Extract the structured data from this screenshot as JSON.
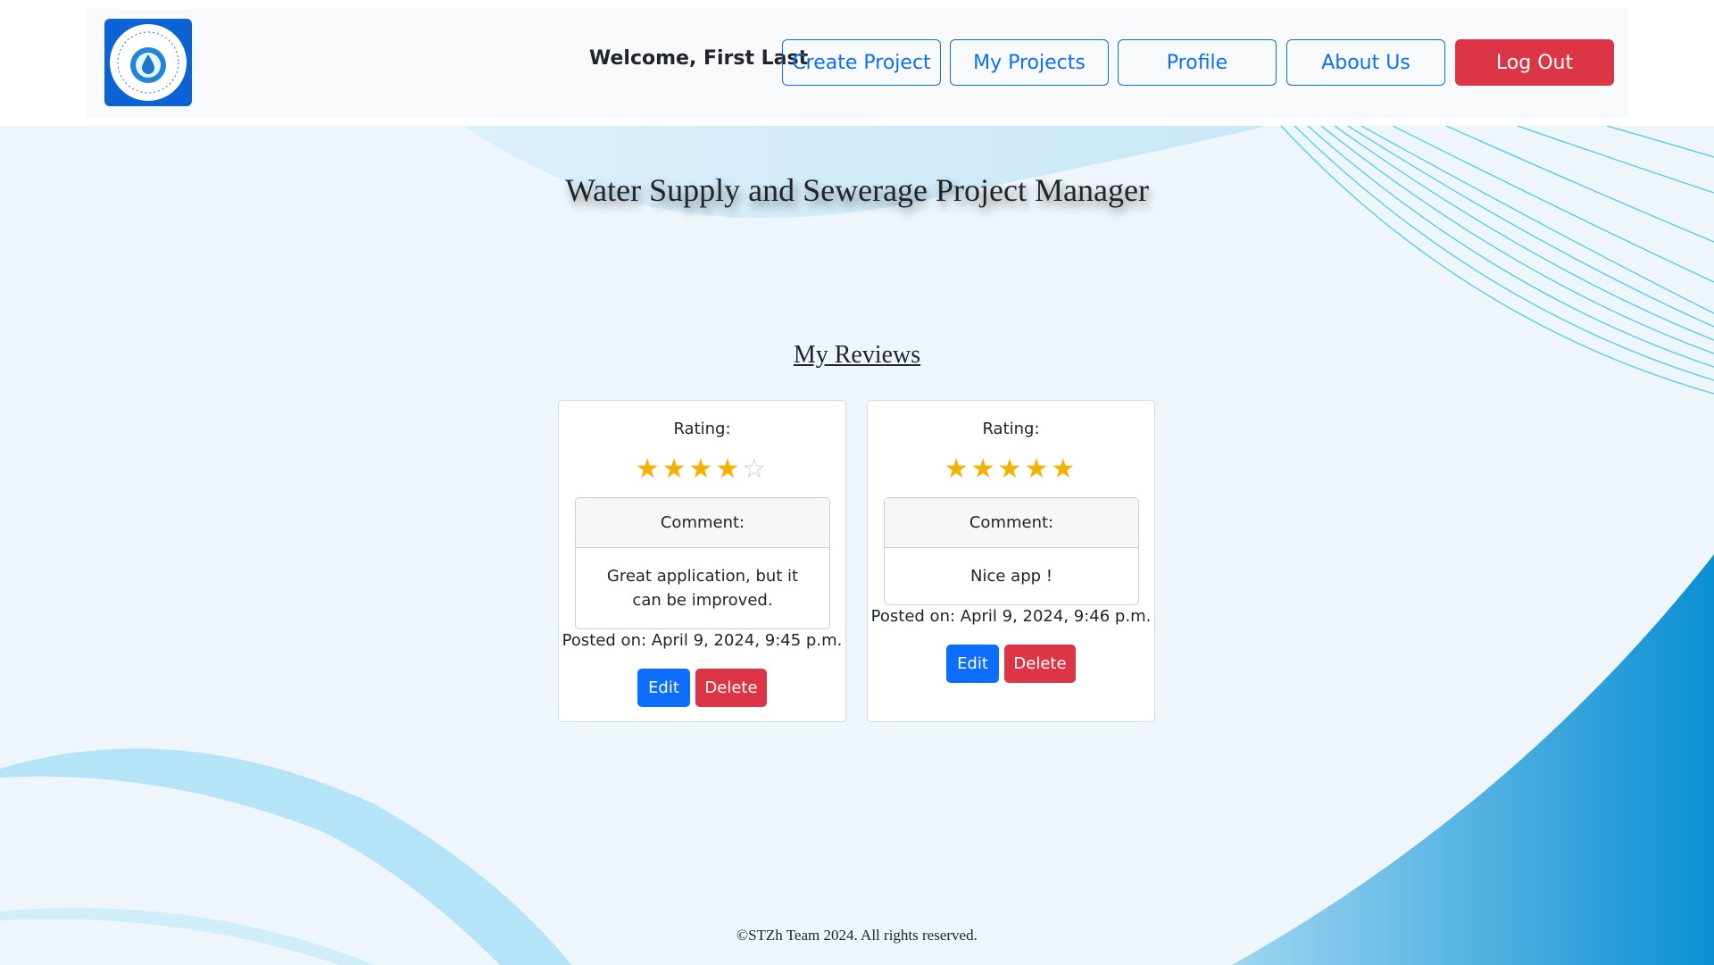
{
  "colors": {
    "primary": "#0d6efd",
    "danger": "#dc3545",
    "star": "#f6b100",
    "background": "#eef6fb"
  },
  "header": {
    "logo_icon": "water-drop-logo",
    "welcome": "Welcome, First Last",
    "nav": {
      "create_project": "Create Project",
      "my_projects": "My Projects",
      "profile": "Profile",
      "about_us": "About Us",
      "log_out": "Log Out"
    }
  },
  "page_title": "Water Supply and Sewerage Project Manager",
  "section_title": "My Reviews",
  "reviews": [
    {
      "rating_label": "Rating:",
      "rating": 4,
      "max_rating": 5,
      "comment_label": "Comment:",
      "comment": "Great application, but it can be improved.",
      "posted": "Posted on: April 9, 2024, 9:45 p.m.",
      "edit_label": "Edit",
      "delete_label": "Delete"
    },
    {
      "rating_label": "Rating:",
      "rating": 5,
      "max_rating": 5,
      "comment_label": "Comment:",
      "comment": "Nice app !",
      "posted": "Posted on: April 9, 2024, 9:46 p.m.",
      "edit_label": "Edit",
      "delete_label": "Delete"
    }
  ],
  "footer": "©STZh Team 2024. All rights reserved."
}
